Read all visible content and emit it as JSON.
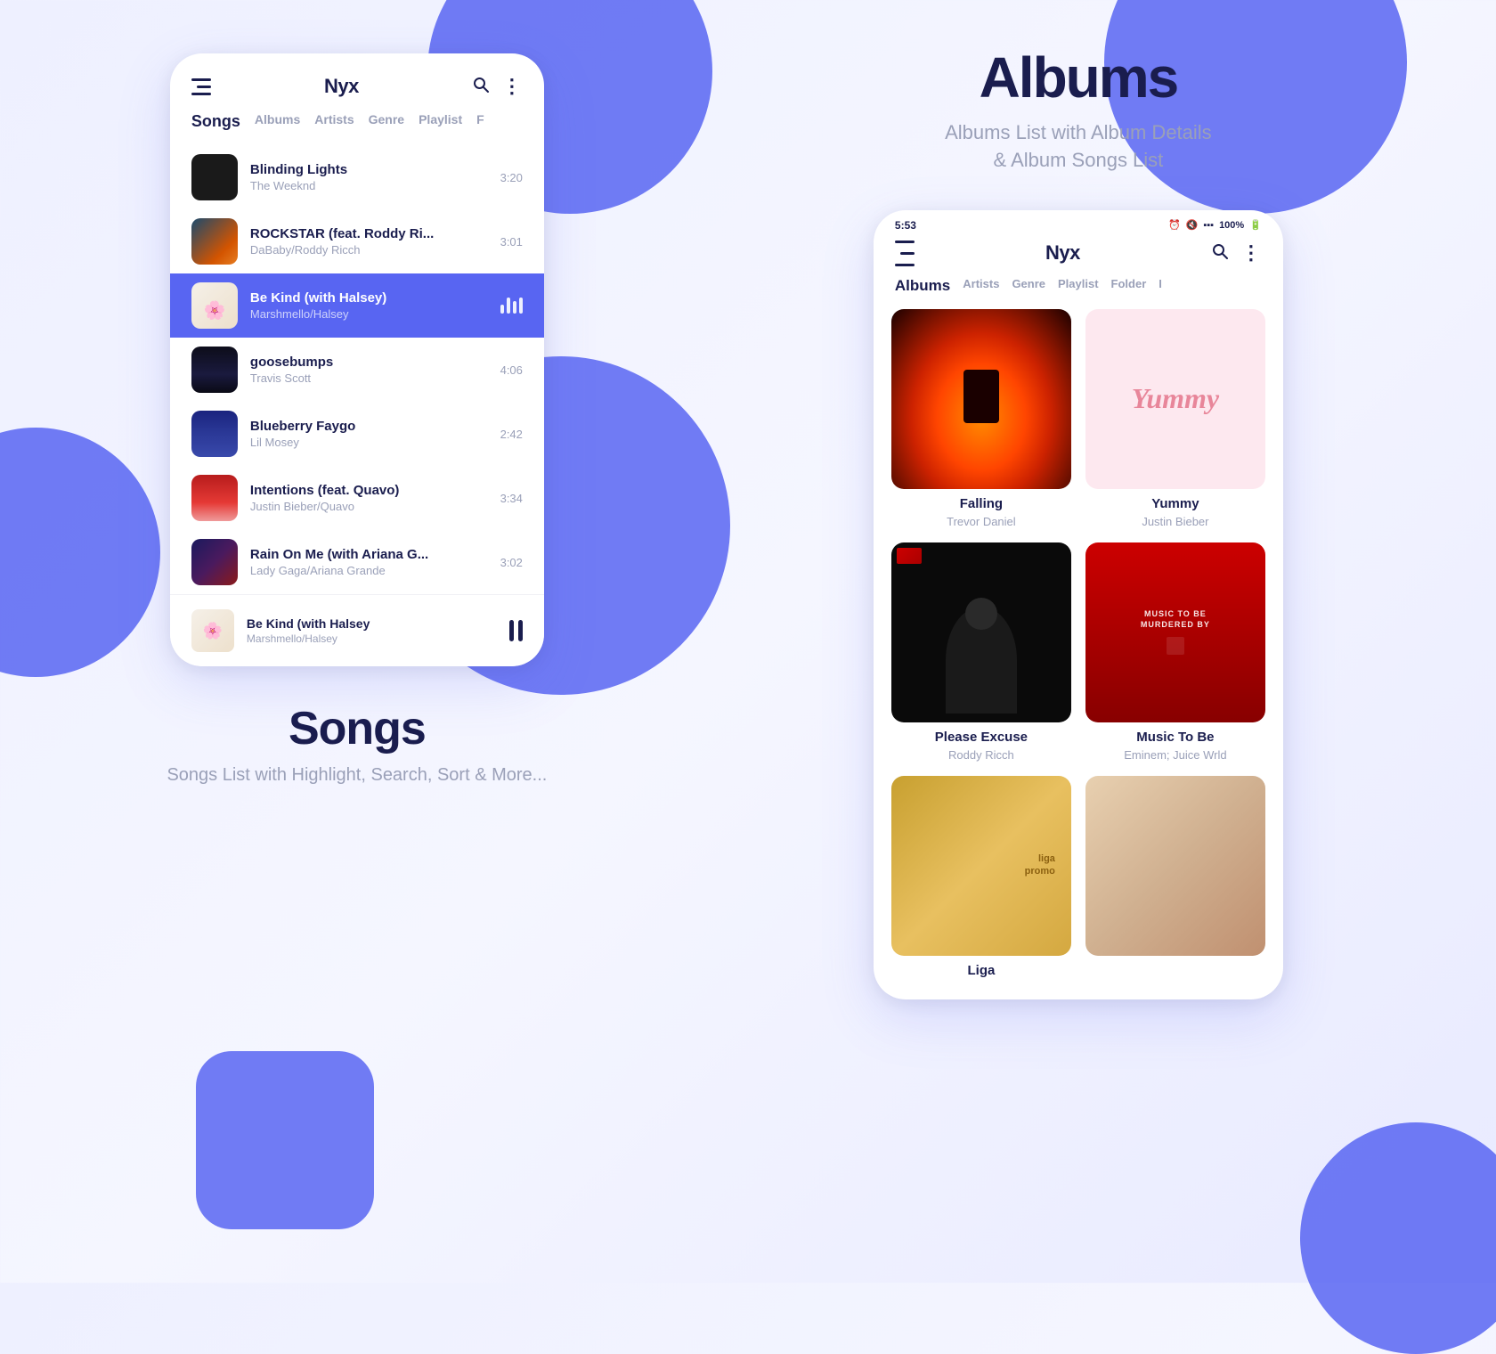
{
  "app": {
    "title": "Nyx",
    "search_icon": "🔍",
    "more_icon": "⋮"
  },
  "background": {
    "circles": [
      "top-left",
      "center-left",
      "center",
      "bottom-left",
      "bottom-right",
      "top-right"
    ]
  },
  "songs_panel": {
    "section_title": "Songs",
    "section_subtitle": "Songs List with Highlight, Search, Sort & More...",
    "nav_tabs": [
      {
        "label": "Songs",
        "active": true
      },
      {
        "label": "Albums"
      },
      {
        "label": "Artists"
      },
      {
        "label": "Genre"
      },
      {
        "label": "Playlist"
      },
      {
        "label": "F"
      }
    ],
    "songs": [
      {
        "id": 1,
        "name": "Blinding Lights",
        "artist": "The Weeknd",
        "duration": "3:20",
        "active": false,
        "art_class": "art-bl-inner"
      },
      {
        "id": 2,
        "name": "ROCKSTAR (feat. Roddy Ri...",
        "artist": "DaBaby/Roddy Ricch",
        "duration": "3:01",
        "active": false,
        "art_class": "art-rs-inner"
      },
      {
        "id": 3,
        "name": "Be Kind (with Halsey)",
        "artist": "Marshmello/Halsey",
        "duration": "",
        "active": true,
        "art_class": "art-bk-inner"
      },
      {
        "id": 4,
        "name": "goosebumps",
        "artist": "Travis Scott",
        "duration": "4:06",
        "active": false,
        "art_class": "art-gb-inner"
      },
      {
        "id": 5,
        "name": "Blueberry Faygo",
        "artist": "Lil Mosey",
        "duration": "2:42",
        "active": false,
        "art_class": "art-bb-inner"
      },
      {
        "id": 6,
        "name": "Intentions (feat. Quavo)",
        "artist": "Justin Bieber/Quavo",
        "duration": "3:34",
        "active": false,
        "art_class": "art-int-inner"
      },
      {
        "id": 7,
        "name": "Rain On Me (with Ariana G...",
        "artist": "Lady Gaga/Ariana Grande",
        "duration": "3:02",
        "active": false,
        "art_class": "art-rom-inner"
      }
    ],
    "mini_player": {
      "name": "Be Kind (with Halsey",
      "artist": "Marshmello/Halsey",
      "art_class": "art-bk-inner"
    }
  },
  "albums_panel": {
    "section_title": "Albums",
    "section_subtitle": "Albums List with Album Details\n& Album Songs List",
    "status_time": "5:53",
    "status_battery": "100%",
    "nav_tabs": [
      {
        "label": "Albums",
        "active": true
      },
      {
        "label": "Artists"
      },
      {
        "label": "Genre"
      },
      {
        "label": "Playlist"
      },
      {
        "label": "Folder"
      },
      {
        "label": "I"
      }
    ],
    "albums": [
      {
        "id": 1,
        "name": "Falling",
        "artist": "Trevor Daniel",
        "art": "falling"
      },
      {
        "id": 2,
        "name": "Yummy",
        "artist": "Justin Bieber",
        "art": "yummy"
      },
      {
        "id": 3,
        "name": "Please Excuse",
        "artist": "Roddy Ricch",
        "art": "please-excuse"
      },
      {
        "id": 4,
        "name": "Music To Be",
        "artist": "Eminem; Juice Wrld",
        "art": "music-to-be"
      },
      {
        "id": 5,
        "name": "Liga",
        "artist": "",
        "art": "liga"
      },
      {
        "id": 6,
        "name": "",
        "artist": "",
        "art": "unknown"
      }
    ]
  }
}
